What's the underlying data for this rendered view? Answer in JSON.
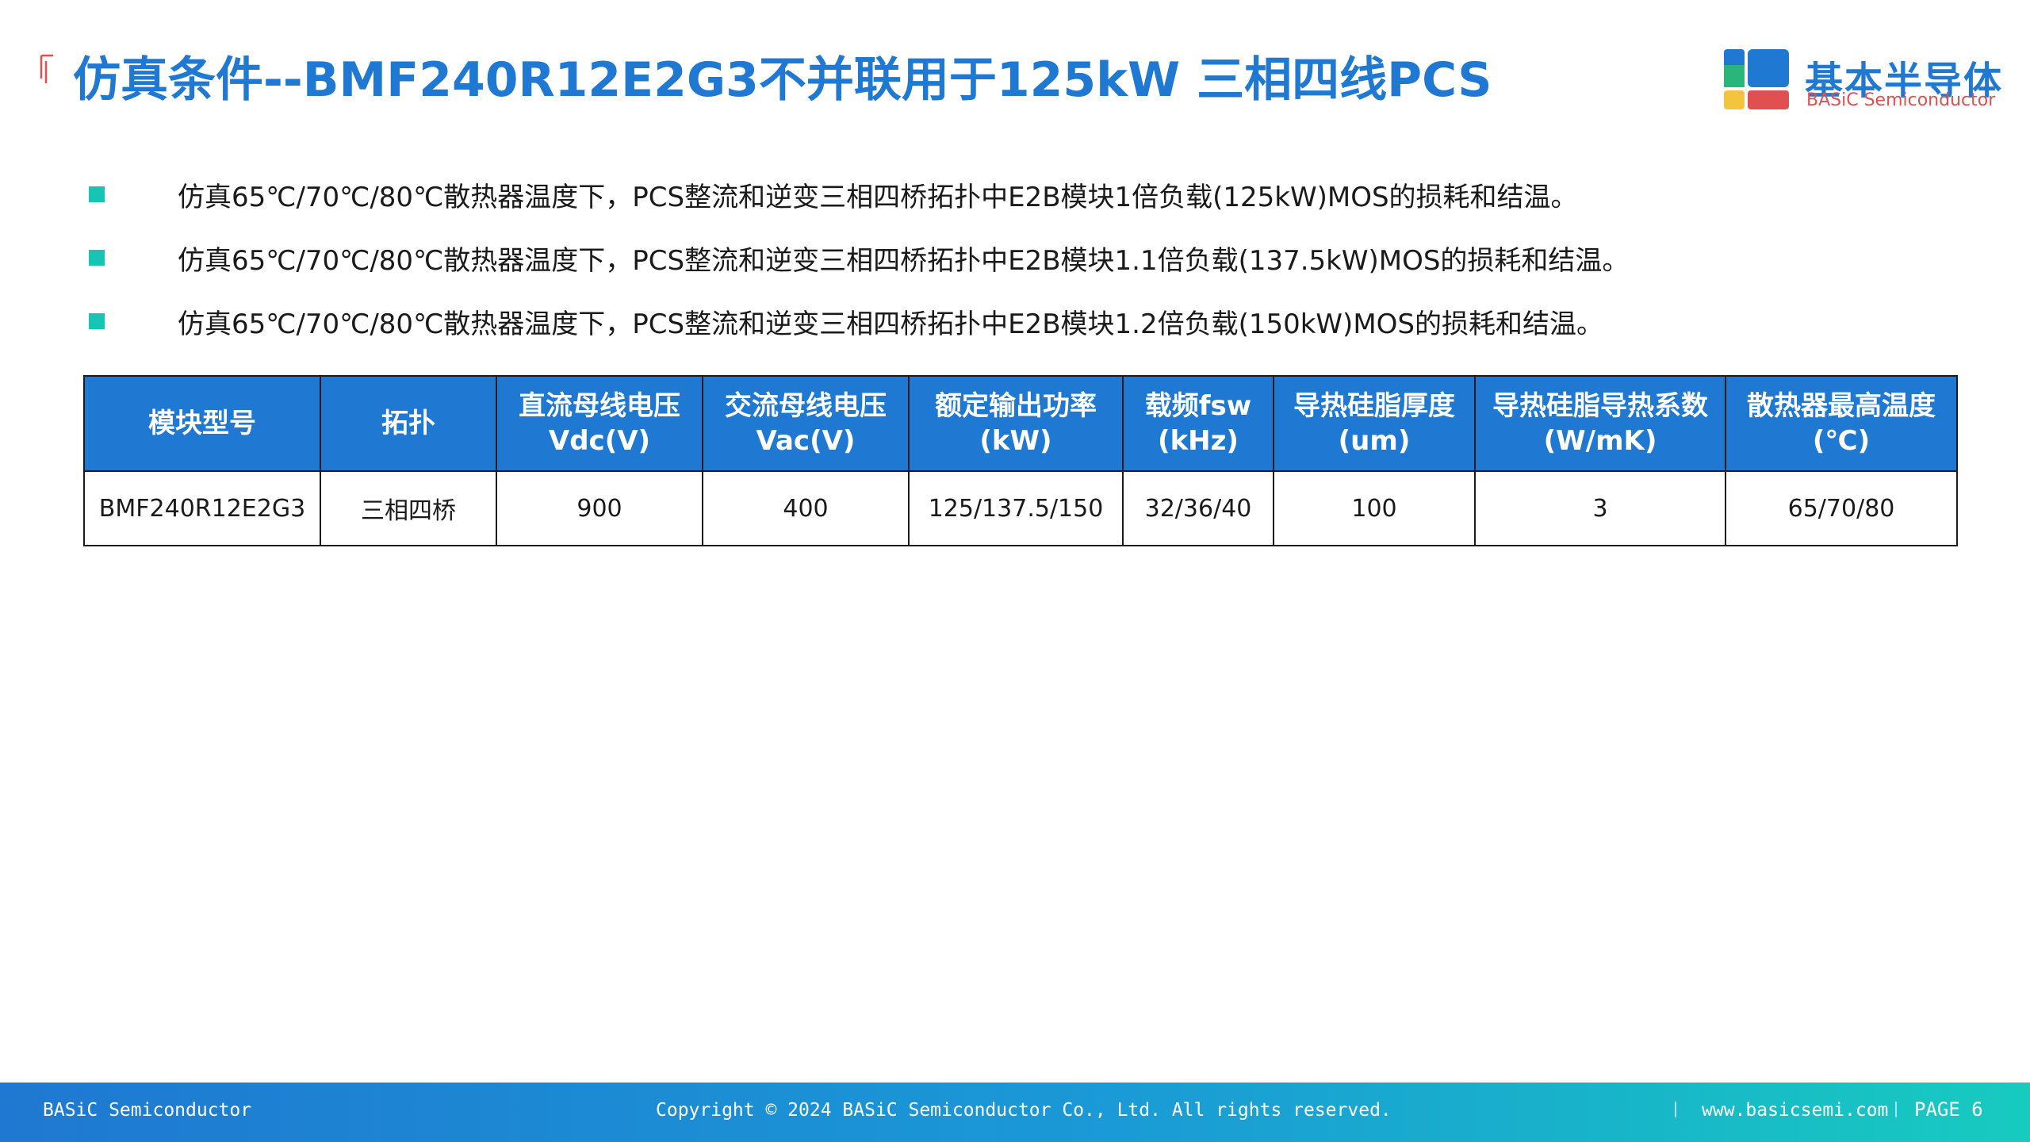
{
  "header": {
    "title": "仿真条件--BMF240R12E2G3不并联用于125kW 三相四线PCS"
  },
  "logo": {
    "cn": "基本半导体",
    "en": "BASiC Semiconductor",
    "colors": {
      "blue": "#1f78d1",
      "green": "#28b67a",
      "yellow": "#f2c53d",
      "red": "#e05050"
    }
  },
  "bullets": [
    {
      "text": "仿真65℃/70℃/80℃散热器温度下，PCS整流和逆变三相四桥拓扑中E2B模块1倍负载(125kW)MOS的损耗和结温。"
    },
    {
      "text": "仿真65℃/70℃/80℃散热器温度下，PCS整流和逆变三相四桥拓扑中E2B模块1.1倍负载(137.5kW)MOS的损耗和结温。"
    },
    {
      "text": "仿真65℃/70℃/80℃散热器温度下，PCS整流和逆变三相四桥拓扑中E2B模块1.2倍负载(150kW)MOS的损耗和结温。"
    }
  ],
  "table": {
    "headers": [
      {
        "line1": "模块型号",
        "line2": ""
      },
      {
        "line1": "拓扑",
        "line2": ""
      },
      {
        "line1": "直流母线电压",
        "line2": "Vdc(V)"
      },
      {
        "line1": "交流母线电压",
        "line2": "Vac(V)"
      },
      {
        "line1": "额定输出功率",
        "line2": "(kW)"
      },
      {
        "line1": "载频fsw",
        "line2": "(kHz)"
      },
      {
        "line1": "导热硅脂厚度",
        "line2": "(um)"
      },
      {
        "line1": "导热硅脂导热系数",
        "line2": "(W/mK)"
      },
      {
        "line1": "散热器最高温度",
        "line2": "(℃)"
      }
    ],
    "rows": [
      [
        "BMF240R12E2G3",
        "三相四桥",
        "900",
        "400",
        "125/137.5/150",
        "32/36/40",
        "100",
        "3",
        "65/70/80"
      ]
    ]
  },
  "footer": {
    "company": "BASiC Semiconductor",
    "copyright": "Copyright © 2024 BASiC Semiconductor Co., Ltd. All rights reserved.",
    "website": "www.basicsemi.com",
    "page": "PAGE 6"
  },
  "colors": {
    "accent": "#1f78d1",
    "bullet": "#18c4b4",
    "title_mark": "#e05050"
  }
}
